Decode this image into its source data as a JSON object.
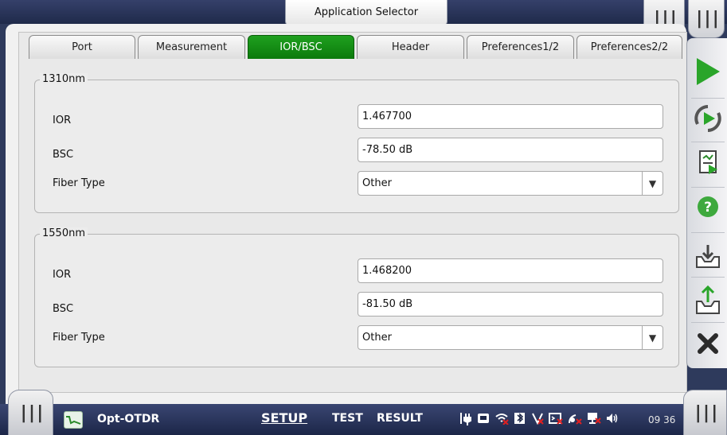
{
  "header": {
    "app_selector": "Application Selector"
  },
  "tabs": [
    {
      "label": "Port",
      "active": false
    },
    {
      "label": "Measurement",
      "active": false
    },
    {
      "label": "IOR/BSC",
      "active": true
    },
    {
      "label": "Header",
      "active": false
    },
    {
      "label": "Preferences1/2",
      "active": false
    },
    {
      "label": "Preferences2/2",
      "active": false
    }
  ],
  "groups": {
    "g1310": {
      "title": "1310nm",
      "ior_label": "IOR",
      "ior_value": "1.467700",
      "bsc_label": "BSC",
      "bsc_value": "-78.50 dB",
      "fiber_label": "Fiber Type",
      "fiber_value": "Other"
    },
    "g1550": {
      "title": "1550nm",
      "ior_label": "IOR",
      "ior_value": "1.468200",
      "bsc_label": "BSC",
      "bsc_value": "-81.50 dB",
      "fiber_label": "Fiber Type",
      "fiber_value": "Other"
    }
  },
  "right_toolbar": [
    "play-icon",
    "refresh-play-icon",
    "report-icon",
    "help-icon",
    "save-icon",
    "load-icon",
    "close-icon"
  ],
  "bottom_bar": {
    "app_name": "Opt-OTDR",
    "nav_setup": "SETUP",
    "nav_test": "TEST",
    "nav_result": "RESULT",
    "clock": "09 36"
  },
  "colors": {
    "active_tab": "#119011",
    "play_green": "#2aa52a",
    "frame_blue": "#2e3a5c"
  }
}
